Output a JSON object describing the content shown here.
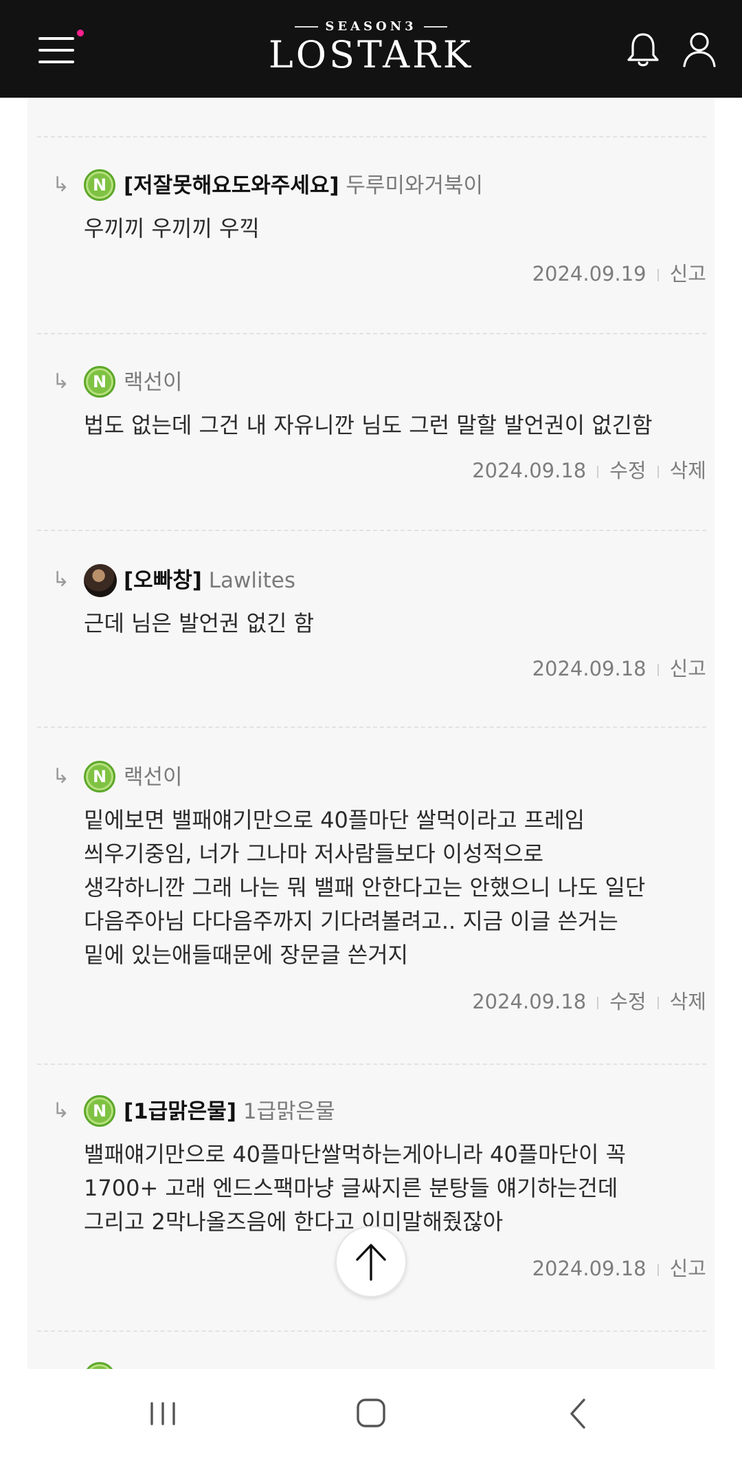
{
  "header": {
    "logo_season": "SEASON3",
    "logo_name": "LOSTARK"
  },
  "comments": [
    {
      "guild": "[저잘못해요도와주세요]",
      "nick": "두루미와거북이",
      "text": "우끼끼 우끼끼 우끽",
      "date": "2024.09.19",
      "actions": [
        "신고"
      ]
    },
    {
      "guild": "",
      "nick": "랙선이",
      "text": "법도 없는데 그건 내 자유니깐 님도 그런 말할 발언권이 없긴함",
      "date": "2024.09.18",
      "actions": [
        "수정",
        "삭제"
      ]
    },
    {
      "guild": "[오빠창]",
      "nick": "Lawlites",
      "text": "근데 님은 발언권 없긴 함",
      "date": "2024.09.18",
      "actions": [
        "신고"
      ]
    },
    {
      "guild": "",
      "nick": "랙선이",
      "text": "밑에보면 밸패얘기만으로 40플마단 쌀먹이라고 프레임\n씌우기중임, 너가 그나마 저사람들보다 이성적으로\n생각하니깐 그래 나는 뭐 밸패 안한다고는 안했으니 나도 일단\n다음주아님 다다음주까지 기다려볼려고.. 지금 이글 쓴거는\n밑에 있는애들때문에 장문글 쓴거지",
      "date": "2024.09.18",
      "actions": [
        "수정",
        "삭제"
      ]
    },
    {
      "guild": "[1급맑은물]",
      "nick": "1급맑은물",
      "text": "밸패얘기만으로 40플마단쌀먹하는게아니라 40플마단이 꼭\n1700+ 고래 엔드스팩마냥 글싸지른 분탕들 얘기하는건데\n그리고 2막나올즈음에 한다고 이미말해줬잖아",
      "date": "2024.09.18",
      "actions": [
        "신고"
      ]
    }
  ],
  "icons": {
    "menu": "hamburger-menu-icon",
    "notification": "bell-icon",
    "profile": "user-icon",
    "reply": "reply-arrow-icon",
    "scroll_top": "arrow-up-icon",
    "nav_recent": "recent-apps-icon",
    "nav_home": "home-icon",
    "nav_back": "back-icon"
  },
  "colors": {
    "header_bg": "#121212",
    "notification_dot": "#ff1f8e",
    "npc_avatar": "#7fc243",
    "content_bg": "#f7f7f7"
  }
}
